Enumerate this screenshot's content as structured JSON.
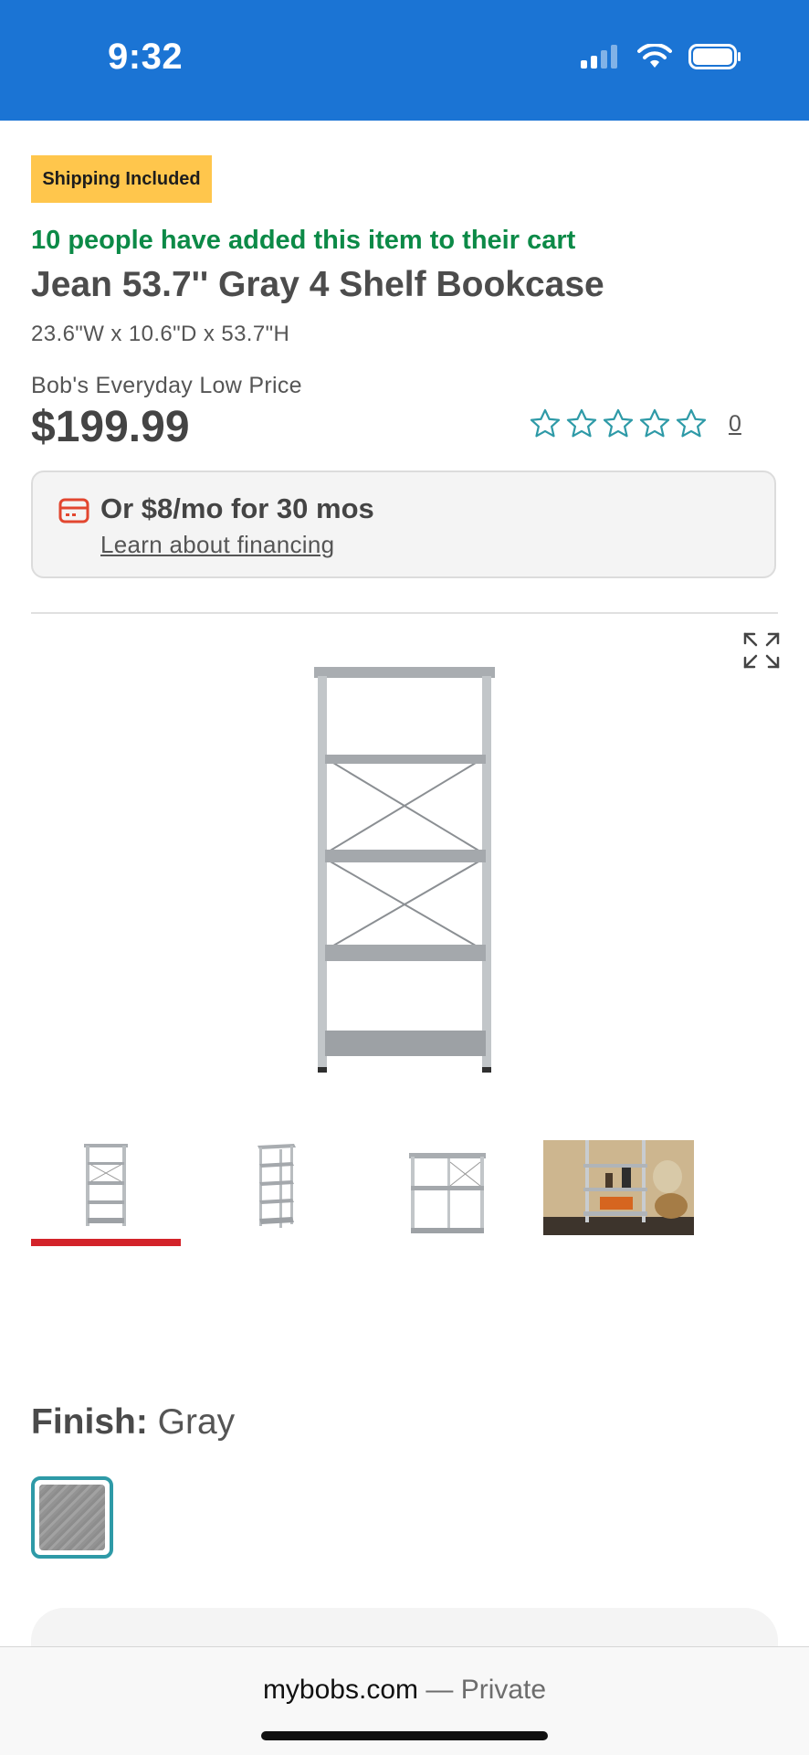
{
  "status_bar": {
    "time": "9:32",
    "bg_color": "#1b74d4"
  },
  "badge": {
    "label": "Shipping Included",
    "color": "#ffc64c"
  },
  "social_proof": {
    "text": "10 people have added this item to their cart",
    "color": "#0c8a47"
  },
  "product": {
    "title": "Jean 53.7'' Gray 4 Shelf Bookcase",
    "dimensions": "23.6\"W x 10.6\"D x 53.7\"H",
    "price_label": "Bob's Everyday Low Price",
    "price": "$199.99",
    "rating_stars": 0,
    "review_count": "0"
  },
  "financing": {
    "title": "Or $8/mo for 30 mos",
    "link": "Learn about financing",
    "icon": "credit-card-icon"
  },
  "gallery": {
    "selected_index": 0,
    "thumbnails": [
      "front-view",
      "angled-view",
      "side-view",
      "room-scene"
    ],
    "accent_color": "#d3232a"
  },
  "finish": {
    "label": "Finish:",
    "value": "Gray"
  },
  "browser": {
    "domain": "mybobs.com",
    "separator": "—",
    "mode": "Private"
  }
}
